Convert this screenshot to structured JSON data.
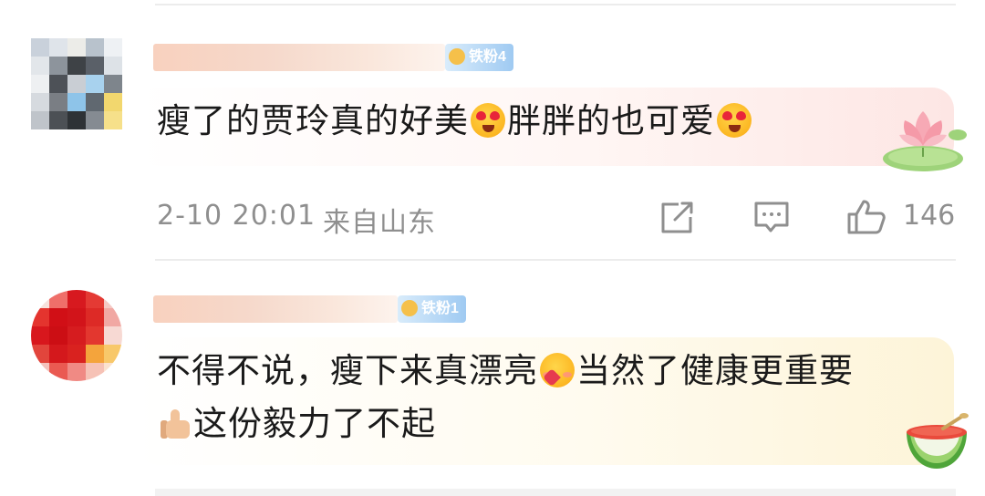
{
  "comments": [
    {
      "author_name": "",
      "badge_label": "铁粉4",
      "text_parts": [
        "瘦了的贾玲真的好美",
        "胖胖的也可爱"
      ],
      "emoji_names": [
        "heart-eyes-emoji",
        "heart-eyes-emoji"
      ],
      "timestamp": "2-10 20:01",
      "location": "来自山东",
      "like_count": "146",
      "bubble_decoration": "lotus-sticker"
    },
    {
      "author_name": "",
      "badge_label": "铁粉1",
      "text_line1_parts": [
        "不得不说，瘦下来真漂亮",
        "当然了健康更重要"
      ],
      "text_line2": "这份毅力了不起",
      "emoji_names": [
        "hugging-heart-emoji",
        "thumbs-up-emoji"
      ],
      "bubble_decoration": "watermelon-sticker"
    }
  ],
  "icons": {
    "share": "share-icon",
    "comment": "comment-icon",
    "like": "thumbs-up-icon"
  },
  "colors": {
    "meta_text": "#8f8f8f",
    "bubble_pink": "#fde6e4",
    "bubble_yellow": "#fdf4d8",
    "badge_blue": "#9fcaf2"
  }
}
